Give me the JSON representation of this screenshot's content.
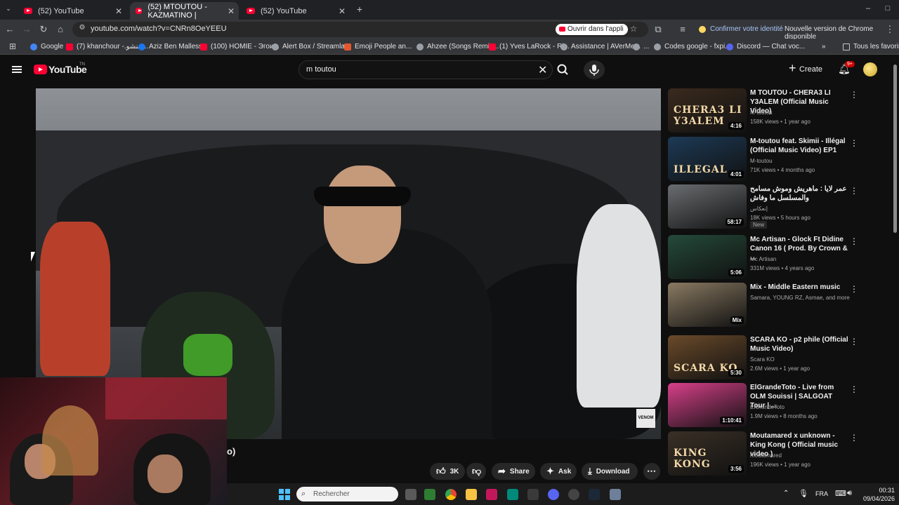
{
  "browser": {
    "tabs": [
      {
        "label": "(52) YouTube"
      },
      {
        "label": "(52) MTOUTOU - KAZMATINO |"
      },
      {
        "label": "(52) YouTube"
      }
    ],
    "url": "youtube.com/watch?v=CNRn8OeYEEU",
    "open_in_app": "Ouvrir dans l'appli",
    "confirm_identity": "Confirmer votre identité",
    "new_version": "Nouvelle version de Chrome disponible",
    "bookmarks": [
      {
        "label": "Google",
        "color": "#4285f4"
      },
      {
        "label": "(7) khanchour -.خنشو...",
        "color": "#ff0033"
      },
      {
        "label": "Aziz Ben Mallessa",
        "color": "#1877f2"
      },
      {
        "label": "(100) HOMIE - Эгои...",
        "color": "#ff0033"
      },
      {
        "label": "Alert Box / Streamla...",
        "color": "#aaaaaa"
      },
      {
        "label": "Emoji People an...",
        "color": "#e4572e"
      },
      {
        "label": "Ahzee (Songs Remix...",
        "color": "#aaaaaa"
      },
      {
        "label": "(1) Yves LaRock - Ri...",
        "color": "#ff0033"
      },
      {
        "label": "Assistance | AVerMe...",
        "color": "#aaaaaa"
      },
      {
        "label": "...",
        "color": "#aaaaaa"
      },
      {
        "label": "Codes google - fxpi...",
        "color": "#aaaaaa"
      },
      {
        "label": "Discord — Chat voc...",
        "color": "#5865f2"
      }
    ],
    "all_favorites": "Tous les favoris"
  },
  "youtube": {
    "logo": "YouTube",
    "logo_tm": "TN",
    "search_query": "m toutou",
    "create": "Create",
    "notifications": "9+"
  },
  "video": {
    "title_visible": "o)",
    "watermark": "VENOM",
    "likes": "3K",
    "share": "Share",
    "ask": "Ask",
    "download": "Download"
  },
  "recommendations": [
    {
      "title": "M TOUTOU - CHERA3 LI Y3ALEM (Official Music Video)",
      "channel": "M-toutou",
      "meta": "158K views • 1 year ago",
      "duration": "4:16",
      "thumb_text": "CHERA3 LI Y3ALEM",
      "thumb_bg": "#3a2a1e"
    },
    {
      "title": "M-toutou feat. Skimii - Illégal (Official Music Video) EP1",
      "channel": "M-toutou",
      "meta": "71K views • 4 months ago",
      "duration": "4:01",
      "thumb_text": "ILLEGAL",
      "thumb_bg": "#1d3a56"
    },
    {
      "title": "عمر لايا : ماهريش وموش مسامح والمسلسل ما وفاش",
      "channel": "إنعكاس",
      "meta": "18K views • 5 hours ago",
      "duration": "58:17",
      "badge": "New",
      "thumb_text": "",
      "thumb_bg": "#6a6d70"
    },
    {
      "title": "Mc Artisan - Glock Ft Didine Canon 16 ( Prod. By Crown & ...",
      "channel": "Mc Artisan",
      "meta": "331M views • 4 years ago",
      "duration": "5:06",
      "thumb_text": "",
      "thumb_bg": "#244a3a"
    },
    {
      "title": "Mix - Middle Eastern music",
      "channel": "Samara, YOUNG RZ, Asmae, and more",
      "meta": "",
      "duration": "Mix",
      "thumb_text": "",
      "thumb_bg": "#8a7a62"
    },
    {
      "title": "SCARA KO - p2 phile (Official Music Video)",
      "channel": "Scara KO",
      "meta": "2.6M views • 1 year ago",
      "duration": "5:30",
      "thumb_text": "SCARA KO",
      "thumb_bg": "#6a4a2a"
    },
    {
      "title": "ElGrandeToto - Live from OLM Souissi | SALGOAT Tour | ...",
      "channel": "ElGrandeToto",
      "meta": "1.9M views • 8 months ago",
      "duration": "1:10:41",
      "thumb_text": "",
      "thumb_bg": "#d8408a"
    },
    {
      "title": "Moutamared x unknown - King Kong ( Official music video )",
      "channel": "moutamared",
      "meta": "196K views • 1 year ago",
      "duration": "3:56",
      "thumb_text": "KING KONG",
      "thumb_bg": "#3a3026"
    }
  ],
  "taskbar": {
    "search_placeholder": "Rechercher",
    "language": "FRA",
    "time": "00:31",
    "date": "09/04/2026"
  }
}
